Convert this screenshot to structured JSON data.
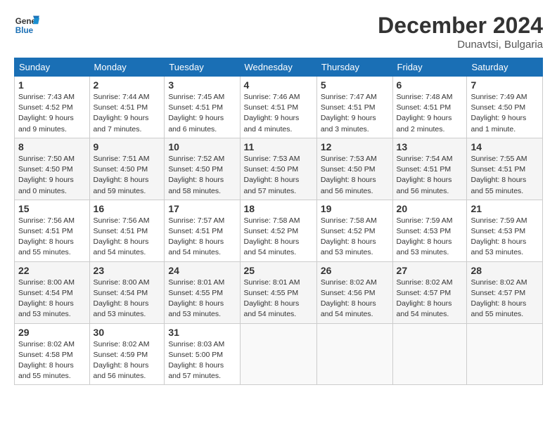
{
  "header": {
    "logo_line1": "General",
    "logo_line2": "Blue",
    "month": "December 2024",
    "location": "Dunavtsi, Bulgaria"
  },
  "weekdays": [
    "Sunday",
    "Monday",
    "Tuesday",
    "Wednesday",
    "Thursday",
    "Friday",
    "Saturday"
  ],
  "weeks": [
    [
      {
        "day": "1",
        "info": "Sunrise: 7:43 AM\nSunset: 4:52 PM\nDaylight: 9 hours\nand 9 minutes."
      },
      {
        "day": "2",
        "info": "Sunrise: 7:44 AM\nSunset: 4:51 PM\nDaylight: 9 hours\nand 7 minutes."
      },
      {
        "day": "3",
        "info": "Sunrise: 7:45 AM\nSunset: 4:51 PM\nDaylight: 9 hours\nand 6 minutes."
      },
      {
        "day": "4",
        "info": "Sunrise: 7:46 AM\nSunset: 4:51 PM\nDaylight: 9 hours\nand 4 minutes."
      },
      {
        "day": "5",
        "info": "Sunrise: 7:47 AM\nSunset: 4:51 PM\nDaylight: 9 hours\nand 3 minutes."
      },
      {
        "day": "6",
        "info": "Sunrise: 7:48 AM\nSunset: 4:51 PM\nDaylight: 9 hours\nand 2 minutes."
      },
      {
        "day": "7",
        "info": "Sunrise: 7:49 AM\nSunset: 4:50 PM\nDaylight: 9 hours\nand 1 minute."
      }
    ],
    [
      {
        "day": "8",
        "info": "Sunrise: 7:50 AM\nSunset: 4:50 PM\nDaylight: 9 hours\nand 0 minutes."
      },
      {
        "day": "9",
        "info": "Sunrise: 7:51 AM\nSunset: 4:50 PM\nDaylight: 8 hours\nand 59 minutes."
      },
      {
        "day": "10",
        "info": "Sunrise: 7:52 AM\nSunset: 4:50 PM\nDaylight: 8 hours\nand 58 minutes."
      },
      {
        "day": "11",
        "info": "Sunrise: 7:53 AM\nSunset: 4:50 PM\nDaylight: 8 hours\nand 57 minutes."
      },
      {
        "day": "12",
        "info": "Sunrise: 7:53 AM\nSunset: 4:50 PM\nDaylight: 8 hours\nand 56 minutes."
      },
      {
        "day": "13",
        "info": "Sunrise: 7:54 AM\nSunset: 4:51 PM\nDaylight: 8 hours\nand 56 minutes."
      },
      {
        "day": "14",
        "info": "Sunrise: 7:55 AM\nSunset: 4:51 PM\nDaylight: 8 hours\nand 55 minutes."
      }
    ],
    [
      {
        "day": "15",
        "info": "Sunrise: 7:56 AM\nSunset: 4:51 PM\nDaylight: 8 hours\nand 55 minutes."
      },
      {
        "day": "16",
        "info": "Sunrise: 7:56 AM\nSunset: 4:51 PM\nDaylight: 8 hours\nand 54 minutes."
      },
      {
        "day": "17",
        "info": "Sunrise: 7:57 AM\nSunset: 4:51 PM\nDaylight: 8 hours\nand 54 minutes."
      },
      {
        "day": "18",
        "info": "Sunrise: 7:58 AM\nSunset: 4:52 PM\nDaylight: 8 hours\nand 54 minutes."
      },
      {
        "day": "19",
        "info": "Sunrise: 7:58 AM\nSunset: 4:52 PM\nDaylight: 8 hours\nand 53 minutes."
      },
      {
        "day": "20",
        "info": "Sunrise: 7:59 AM\nSunset: 4:53 PM\nDaylight: 8 hours\nand 53 minutes."
      },
      {
        "day": "21",
        "info": "Sunrise: 7:59 AM\nSunset: 4:53 PM\nDaylight: 8 hours\nand 53 minutes."
      }
    ],
    [
      {
        "day": "22",
        "info": "Sunrise: 8:00 AM\nSunset: 4:54 PM\nDaylight: 8 hours\nand 53 minutes."
      },
      {
        "day": "23",
        "info": "Sunrise: 8:00 AM\nSunset: 4:54 PM\nDaylight: 8 hours\nand 53 minutes."
      },
      {
        "day": "24",
        "info": "Sunrise: 8:01 AM\nSunset: 4:55 PM\nDaylight: 8 hours\nand 53 minutes."
      },
      {
        "day": "25",
        "info": "Sunrise: 8:01 AM\nSunset: 4:55 PM\nDaylight: 8 hours\nand 54 minutes."
      },
      {
        "day": "26",
        "info": "Sunrise: 8:02 AM\nSunset: 4:56 PM\nDaylight: 8 hours\nand 54 minutes."
      },
      {
        "day": "27",
        "info": "Sunrise: 8:02 AM\nSunset: 4:57 PM\nDaylight: 8 hours\nand 54 minutes."
      },
      {
        "day": "28",
        "info": "Sunrise: 8:02 AM\nSunset: 4:57 PM\nDaylight: 8 hours\nand 55 minutes."
      }
    ],
    [
      {
        "day": "29",
        "info": "Sunrise: 8:02 AM\nSunset: 4:58 PM\nDaylight: 8 hours\nand 55 minutes."
      },
      {
        "day": "30",
        "info": "Sunrise: 8:02 AM\nSunset: 4:59 PM\nDaylight: 8 hours\nand 56 minutes."
      },
      {
        "day": "31",
        "info": "Sunrise: 8:03 AM\nSunset: 5:00 PM\nDaylight: 8 hours\nand 57 minutes."
      },
      {
        "day": "",
        "info": ""
      },
      {
        "day": "",
        "info": ""
      },
      {
        "day": "",
        "info": ""
      },
      {
        "day": "",
        "info": ""
      }
    ]
  ]
}
